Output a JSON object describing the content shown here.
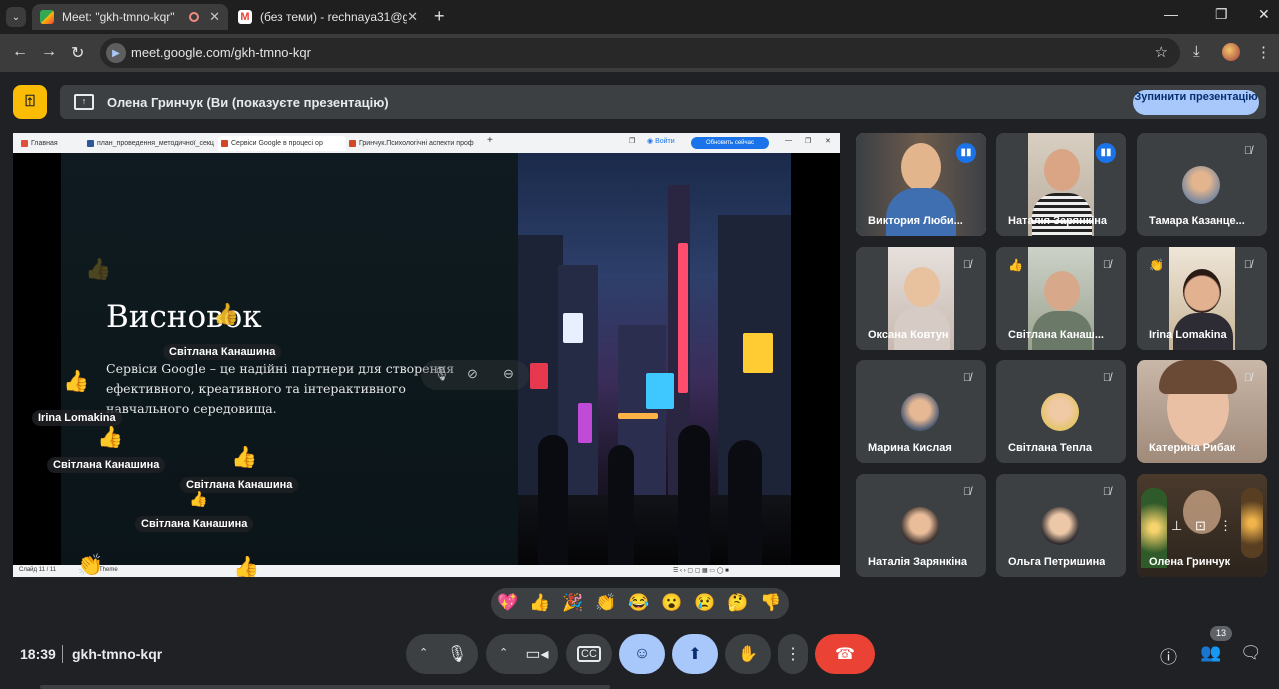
{
  "browser": {
    "tabs": [
      {
        "title": "Meet: \"gkh-tmno-kqr\"",
        "active": true
      },
      {
        "title": "(без теми) - rechnaya31@gmail",
        "active": false
      }
    ],
    "url": "meet.google.com/gkh-tmno-kqr"
  },
  "banner": {
    "presenter_text": "Олена Гринчук (Ви (показуєте презентацію)",
    "stop_label": "Зупинити презентацію"
  },
  "shared_screen": {
    "tabs": [
      {
        "title": "Главная"
      },
      {
        "title": "план_проведення_методичної_секц"
      },
      {
        "title": "Сервіси Google в процесі ор"
      },
      {
        "title": "Гринчук.Психологічні аспекти проф"
      }
    ],
    "signin": "Войти",
    "update_label": "Обновить сейчас",
    "slide_title": "Висновок",
    "slide_body": "Сервіси Google – це надійні партнери для створення ефективного, креативного та інтерактивного навчального середовища.",
    "status_slide": "Слайд 11 / 11",
    "status_theme": "Theme"
  },
  "floating_reactions": [
    {
      "name": "Світлана Канашина",
      "emoji": "👍"
    },
    {
      "name": "Irina Lomakina",
      "emoji": "👍"
    },
    {
      "name": "Світлана Канашина",
      "emoji": "👍"
    },
    {
      "name": "Світлана Канашина",
      "emoji": "👍"
    },
    {
      "name": "Світлана Канашина",
      "emoji": "👍"
    },
    {
      "name": "Світлана Канашина",
      "emoji": "👍"
    }
  ],
  "participants": [
    {
      "name": "Виктория Люби...",
      "state": "speaking"
    },
    {
      "name": "Наталія Зарянкіна",
      "state": "speaking"
    },
    {
      "name": "Тамара Казанце...",
      "state": "muted"
    },
    {
      "name": "Оксана Ковтун",
      "state": "muted"
    },
    {
      "name": "Світлана Канаш...",
      "state": "muted",
      "reaction": "👍"
    },
    {
      "name": "Irina Lomakina",
      "state": "muted",
      "reaction": "👏"
    },
    {
      "name": "Марина Кислая",
      "state": "muted"
    },
    {
      "name": "Світлана Тепла",
      "state": "muted"
    },
    {
      "name": "Катерина Рибак",
      "state": "muted"
    },
    {
      "name": "Наталія Зарянкіна",
      "state": "muted"
    },
    {
      "name": "Ольга Петришина",
      "state": "muted"
    },
    {
      "name": "Олена Гринчук",
      "state": "self"
    }
  ],
  "reaction_bar": [
    "💖",
    "👍",
    "🎉",
    "👏",
    "😂",
    "😮",
    "😢",
    "🤔",
    "👎"
  ],
  "bottom": {
    "time": "18:39",
    "meeting_code": "gkh-tmno-kqr",
    "people_count": "13"
  },
  "colors": {
    "background": "#202124",
    "surface": "#3c4043",
    "accent": "#a8c7fa",
    "hangup": "#ea4335",
    "logo": "#fbbc04"
  }
}
